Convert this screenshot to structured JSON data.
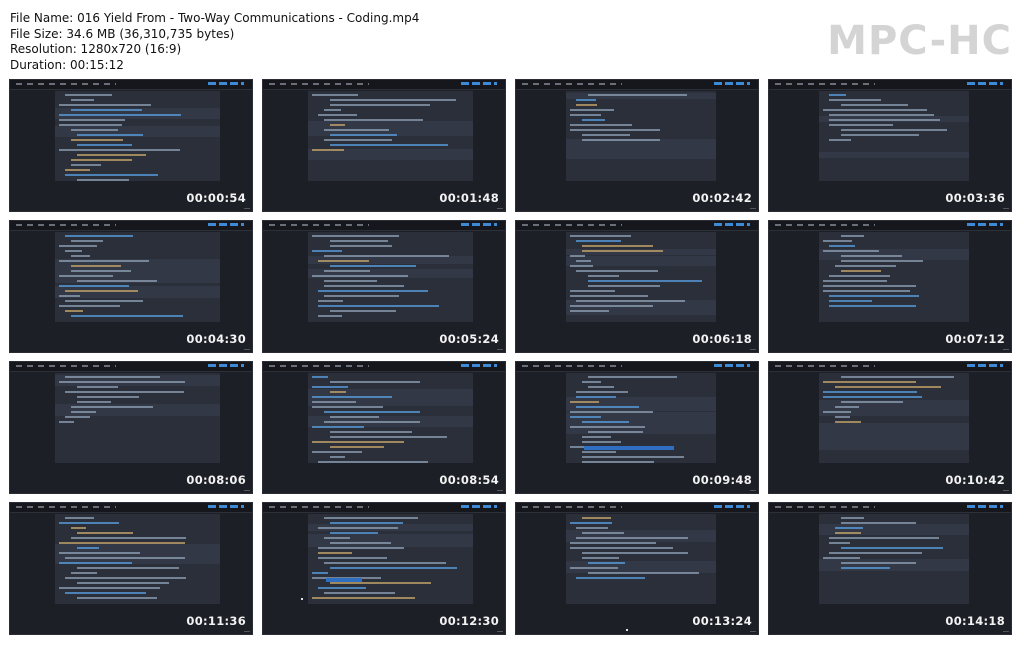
{
  "info": {
    "file_name": "File Name: 016 Yield From - Two-Way Communications - Coding.mp4",
    "file_size": "File Size: 34.6 MB (36,310,735 bytes)",
    "resolution": "Resolution: 1280x720 (16:9)",
    "duration": "Duration: 00:15:12"
  },
  "logo": "MPC-HC",
  "thumbnails": [
    {
      "timestamp": "00:00:54"
    },
    {
      "timestamp": "00:01:48"
    },
    {
      "timestamp": "00:02:42"
    },
    {
      "timestamp": "00:03:36"
    },
    {
      "timestamp": "00:04:30"
    },
    {
      "timestamp": "00:05:24"
    },
    {
      "timestamp": "00:06:18"
    },
    {
      "timestamp": "00:07:12"
    },
    {
      "timestamp": "00:08:06"
    },
    {
      "timestamp": "00:08:54"
    },
    {
      "timestamp": "00:09:48"
    },
    {
      "timestamp": "00:10:42"
    },
    {
      "timestamp": "00:11:36"
    },
    {
      "timestamp": "00:12:30"
    },
    {
      "timestamp": "00:13:24"
    },
    {
      "timestamp": "00:14:18"
    }
  ]
}
